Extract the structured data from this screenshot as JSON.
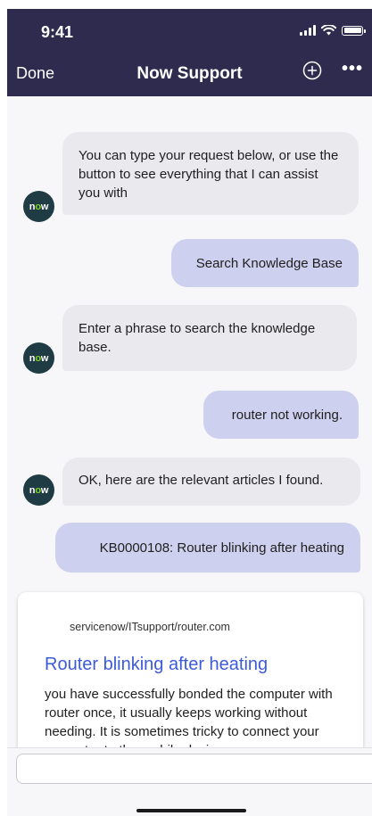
{
  "status_bar": {
    "time": "9:41"
  },
  "nav": {
    "done_label": "Done",
    "title": "Now Support",
    "more_label": "•••"
  },
  "avatar_text": {
    "prefix": "n",
    "middle": "o",
    "suffix": "w"
  },
  "messages": [
    {
      "from": "bot",
      "text": "You can type your request below, or use the button to see everything that I can assist you with"
    },
    {
      "from": "user",
      "text": "Search Knowledge Base"
    },
    {
      "from": "bot",
      "text": "Enter a phrase to search the knowledge base."
    },
    {
      "from": "user",
      "text": "router not working."
    },
    {
      "from": "bot",
      "text": "OK, here are the relevant articles I found."
    },
    {
      "from": "user",
      "text": "KB0000108: Router blinking after heating"
    }
  ],
  "article_card": {
    "url": "servicenow/ITsupport/router.com",
    "title": "Router blinking after heating",
    "snippet": "you have successfully bonded the computer with router once, it usually keeps working without needing. It is sometimes tricky to connect your computer to the mobile device"
  },
  "input": {
    "placeholder": "",
    "value": ""
  },
  "colors": {
    "header": "#2e2b4e",
    "bot_bubble": "#e9e9ee",
    "user_bubble": "#cdd0ee",
    "link": "#3d5bd9",
    "avatar": "#1f3b44"
  }
}
